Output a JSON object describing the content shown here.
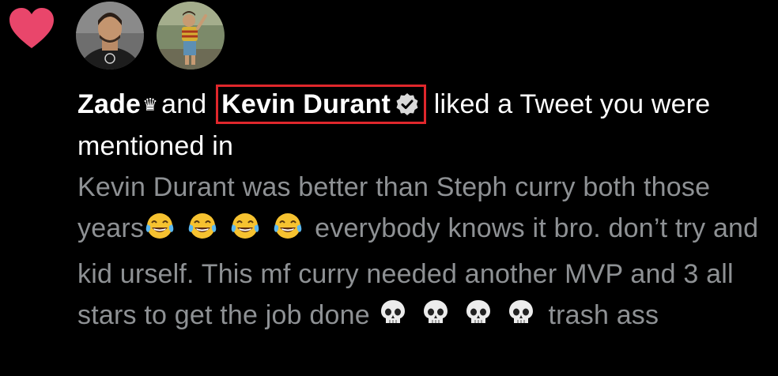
{
  "notification": {
    "icon": "heart-icon",
    "heart_color": "#e9466b",
    "highlight_color": "#e0272c",
    "user1": {
      "name": "Zade",
      "badge": "crown-icon"
    },
    "conjunction": "and",
    "user2": {
      "name": "Kevin Durant",
      "badge": "verified-icon"
    },
    "action": "liked a Tweet you were mentioned in",
    "tweet_part1": "Kevin Durant was better than Steph curry both those years",
    "tweet_emoji_1": "tears-of-joy-emoji",
    "tweet_part2": "everybody knows it bro. don’t try and kid urself. This mf curry needed another MVP and 3 all stars to get the job done",
    "tweet_emoji_2": "skull-emoji",
    "tweet_part3": "trash ass"
  }
}
